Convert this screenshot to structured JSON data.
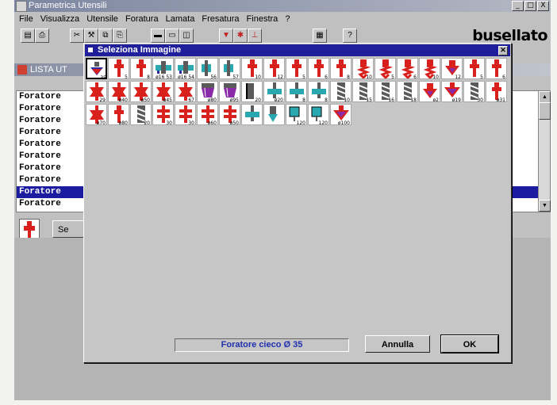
{
  "app": {
    "title": "Parametrica Utensili",
    "win_buttons": [
      "_",
      "□",
      "X"
    ],
    "brand": "busellato"
  },
  "menu": [
    "File",
    "Visualizza",
    "Utensile",
    "Foratura",
    "Lamata",
    "Fresatura",
    "Finestra",
    "?"
  ],
  "background_window": {
    "title": "LISTA UT",
    "items": [
      {
        "label": "Foratore",
        "selected": false
      },
      {
        "label": "Foratore",
        "selected": false
      },
      {
        "label": "Foratore",
        "selected": false
      },
      {
        "label": "Foratore",
        "selected": false
      },
      {
        "label": "Foratore",
        "selected": false
      },
      {
        "label": "Foratore",
        "selected": false
      },
      {
        "label": "Foratore",
        "selected": false
      },
      {
        "label": "Foratore",
        "selected": false
      },
      {
        "label": "Foratore",
        "selected": true
      },
      {
        "label": "Foratore",
        "selected": false
      }
    ],
    "button_label": "Se"
  },
  "dialog": {
    "title": "Seleziona Immagine",
    "status": "Foratore cieco  Ø 35",
    "cancel": "Annulla",
    "ok": "OK",
    "images": [
      {
        "icon": "blind-drill-icon",
        "label": "35",
        "selected": true
      },
      {
        "icon": "drill-icon",
        "label": "5",
        "selected": false
      },
      {
        "icon": "drill-icon",
        "label": "8",
        "selected": false
      },
      {
        "icon": "hinge-cutter-icon",
        "label": "ø16 53",
        "selected": false
      },
      {
        "icon": "hinge-cutter-icon",
        "label": "ø16 54",
        "selected": false
      },
      {
        "icon": "cutter-icon",
        "label": "56",
        "selected": false
      },
      {
        "icon": "cutter-icon",
        "label": "57",
        "selected": false
      },
      {
        "icon": "drill-icon",
        "label": "10",
        "selected": false
      },
      {
        "icon": "drill-icon",
        "label": "12",
        "selected": false
      },
      {
        "icon": "drill-icon",
        "label": "5",
        "selected": false
      },
      {
        "icon": "drill-icon",
        "label": "6",
        "selected": false
      },
      {
        "icon": "drill-icon",
        "label": "8",
        "selected": false
      },
      {
        "icon": "spiral-drill-icon",
        "label": "10",
        "selected": false
      },
      {
        "icon": "spiral-drill-icon",
        "label": "5",
        "selected": false
      },
      {
        "icon": "spiral-drill-icon",
        "label": "6",
        "selected": false
      },
      {
        "icon": "spiral-drill-icon",
        "label": "10",
        "selected": false
      },
      {
        "icon": "countersink-icon",
        "label": "12",
        "selected": false
      },
      {
        "icon": "drill-icon",
        "label": "5",
        "selected": false
      },
      {
        "icon": "drill-icon",
        "label": "6",
        "selected": false
      },
      {
        "icon": "profile-cutter-icon",
        "label": "29",
        "selected": false
      },
      {
        "icon": "profile-cutter-icon",
        "label": "ø40",
        "selected": false
      },
      {
        "icon": "profile-cutter-icon",
        "label": "ø50",
        "selected": false
      },
      {
        "icon": "profile-cutter-icon",
        "label": "ø45",
        "selected": false
      },
      {
        "icon": "profile-cutter-icon",
        "label": "67",
        "selected": false
      },
      {
        "icon": "router-icon",
        "label": "ø80",
        "selected": false
      },
      {
        "icon": "router-icon",
        "label": "ø95",
        "selected": false
      },
      {
        "icon": "shank-icon",
        "label": "20",
        "selected": false
      },
      {
        "icon": "saw-blade-icon",
        "label": "ø20",
        "selected": false
      },
      {
        "icon": "saw-blade-icon",
        "label": "8",
        "selected": false
      },
      {
        "icon": "saw-blade-icon",
        "label": "8",
        "selected": false
      },
      {
        "icon": "spiral-bit-icon",
        "label": "10",
        "selected": false
      },
      {
        "icon": "spiral-bit-icon",
        "label": "15",
        "selected": false
      },
      {
        "icon": "spiral-bit-icon",
        "label": "16",
        "selected": false
      },
      {
        "icon": "spiral-bit-icon",
        "label": "18",
        "selected": false
      },
      {
        "icon": "countersink-icon",
        "label": "ø2",
        "selected": false
      },
      {
        "icon": "v-groove-icon",
        "label": "ø19",
        "selected": false
      },
      {
        "icon": "spiral-bit-icon",
        "label": "30",
        "selected": false
      },
      {
        "icon": "drill-icon",
        "label": "ø31",
        "selected": false
      },
      {
        "icon": "profile-cutter-icon",
        "label": "ø70",
        "selected": false
      },
      {
        "icon": "drill-icon",
        "label": "ø80",
        "selected": false
      },
      {
        "icon": "spiral-bit-icon",
        "label": "20",
        "selected": false
      },
      {
        "icon": "stacked-cutter-icon",
        "label": "30",
        "selected": false
      },
      {
        "icon": "stacked-cutter-icon",
        "label": "30",
        "selected": false
      },
      {
        "icon": "stacked-cutter-icon",
        "label": "ø60",
        "selected": false
      },
      {
        "icon": "stacked-cutter-icon",
        "label": "ø50",
        "selected": false
      },
      {
        "icon": "saw-blade-icon",
        "label": "",
        "selected": false
      },
      {
        "icon": "aggregate-icon",
        "label": "",
        "selected": false
      },
      {
        "icon": "box-tool-icon",
        "label": "120",
        "selected": false
      },
      {
        "icon": "box-tool-icon",
        "label": "120",
        "selected": false
      },
      {
        "icon": "v-groove-icon",
        "label": "ø100",
        "selected": false
      }
    ]
  },
  "colors": {
    "tool_red": "#d8201c",
    "tool_blue": "#2a2aa8",
    "tool_teal": "#2aa8b0",
    "tool_gray": "#5a5a5a",
    "tool_purple": "#8a2aa8"
  }
}
